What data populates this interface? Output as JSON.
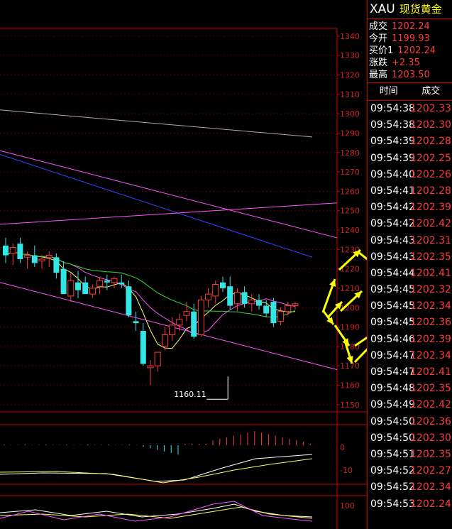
{
  "instrument": {
    "code": "XAU",
    "name": "现货黄金"
  },
  "quote": [
    {
      "label": "成交",
      "value": "1202.24"
    },
    {
      "label": "今开",
      "value": "1199.93"
    },
    {
      "label": "买价1",
      "value": "1202.24"
    },
    {
      "label": "涨跌",
      "value": "+2.35"
    },
    {
      "label": "最高",
      "value": "1203.50"
    }
  ],
  "ticks_header": {
    "time": "时间",
    "price": "成交"
  },
  "ticks": [
    {
      "time": "09:54:38",
      "price": "1202.33"
    },
    {
      "time": "09:54:38",
      "price": "1202.30"
    },
    {
      "time": "09:54:39",
      "price": "1202.28"
    },
    {
      "time": "09:54:39",
      "price": "1202.25"
    },
    {
      "time": "09:54:40",
      "price": "1202.26"
    },
    {
      "time": "09:54:41",
      "price": "1202.28"
    },
    {
      "time": "09:54:42",
      "price": "1202.39"
    },
    {
      "time": "09:54:42",
      "price": "1202.42"
    },
    {
      "time": "09:54:43",
      "price": "1202.31"
    },
    {
      "time": "09:54:43",
      "price": "1202.35"
    },
    {
      "time": "09:54:44",
      "price": "1202.41"
    },
    {
      "time": "09:54:45",
      "price": "1202.32"
    },
    {
      "time": "09:54:45",
      "price": "1202.34"
    },
    {
      "time": "09:54:45",
      "price": "1202.36"
    },
    {
      "time": "09:54:46",
      "price": "1202.39"
    },
    {
      "time": "09:54:47",
      "price": "1202.34"
    },
    {
      "time": "09:54:47",
      "price": "1202.41"
    },
    {
      "time": "09:54:48",
      "price": "1202.35"
    },
    {
      "time": "09:54:49",
      "price": "1202.42"
    },
    {
      "time": "09:54:50",
      "price": "1202.36"
    },
    {
      "time": "09:54:50",
      "price": "1202.30"
    },
    {
      "time": "09:54:51",
      "price": "1202.35"
    },
    {
      "time": "09:54:52",
      "price": "1202.27"
    },
    {
      "time": "09:54:52",
      "price": "1202.34"
    },
    {
      "time": "09:54:53",
      "price": "1202.24"
    }
  ],
  "colors": {
    "up": "#ff3b3b",
    "down": "#33e5e5",
    "axis": "#cc0000",
    "ma5": "#ffff66",
    "ma10": "#ff55ff",
    "ma20": "#33dd33",
    "ma60": "#3344ff",
    "ma120": "#aaaaaa",
    "channel": "#ff55ff",
    "arrow": "#ffff00"
  },
  "chart_data": {
    "type": "candlestick",
    "ylim": [
      1147,
      1344
    ],
    "yticks": [
      1150,
      1160,
      1170,
      1180,
      1190,
      1200,
      1210,
      1220,
      1230,
      1240,
      1250,
      1260,
      1270,
      1280,
      1290,
      1300,
      1310,
      1320,
      1330,
      1340
    ],
    "annotations": [
      {
        "text": "1160.11",
        "value": 1160.11,
        "index": 31
      }
    ],
    "candles": [
      {
        "o": 1232,
        "h": 1236,
        "l": 1223,
        "c": 1227
      },
      {
        "o": 1228,
        "h": 1233,
        "l": 1222,
        "c": 1231
      },
      {
        "o": 1233,
        "h": 1236,
        "l": 1223,
        "c": 1225
      },
      {
        "o": 1226,
        "h": 1229,
        "l": 1220,
        "c": 1227
      },
      {
        "o": 1227,
        "h": 1232,
        "l": 1221,
        "c": 1223
      },
      {
        "o": 1224,
        "h": 1227,
        "l": 1220,
        "c": 1225
      },
      {
        "o": 1226,
        "h": 1229,
        "l": 1221,
        "c": 1227
      },
      {
        "o": 1226,
        "h": 1228,
        "l": 1215,
        "c": 1218
      },
      {
        "o": 1220,
        "h": 1224,
        "l": 1212,
        "c": 1207
      },
      {
        "o": 1206,
        "h": 1218,
        "l": 1203,
        "c": 1214
      },
      {
        "o": 1213,
        "h": 1219,
        "l": 1205,
        "c": 1209
      },
      {
        "o": 1213,
        "h": 1216,
        "l": 1208,
        "c": 1207
      },
      {
        "o": 1207,
        "h": 1212,
        "l": 1205,
        "c": 1210
      },
      {
        "o": 1211,
        "h": 1216,
        "l": 1207,
        "c": 1214
      },
      {
        "o": 1214,
        "h": 1217,
        "l": 1209,
        "c": 1213
      },
      {
        "o": 1213,
        "h": 1216,
        "l": 1210,
        "c": 1215
      },
      {
        "o": 1213,
        "h": 1217,
        "l": 1210,
        "c": 1212
      },
      {
        "o": 1211,
        "h": 1214,
        "l": 1195,
        "c": 1196
      },
      {
        "o": 1193,
        "h": 1198,
        "l": 1188,
        "c": 1192
      },
      {
        "o": 1188,
        "h": 1192,
        "l": 1170,
        "c": 1171
      },
      {
        "o": 1169,
        "h": 1173,
        "l": 1160,
        "c": 1170
      },
      {
        "o": 1170,
        "h": 1176,
        "l": 1167,
        "c": 1177
      },
      {
        "o": 1180,
        "h": 1190,
        "l": 1178,
        "c": 1186
      },
      {
        "o": 1186,
        "h": 1195,
        "l": 1183,
        "c": 1191
      },
      {
        "o": 1191,
        "h": 1197,
        "l": 1188,
        "c": 1194
      },
      {
        "o": 1196,
        "h": 1203,
        "l": 1193,
        "c": 1198
      },
      {
        "o": 1198,
        "h": 1202,
        "l": 1184,
        "c": 1185
      },
      {
        "o": 1186,
        "h": 1206,
        "l": 1185,
        "c": 1204
      },
      {
        "o": 1204,
        "h": 1210,
        "l": 1200,
        "c": 1207
      },
      {
        "o": 1206,
        "h": 1214,
        "l": 1202,
        "c": 1212
      },
      {
        "o": 1213,
        "h": 1216,
        "l": 1208,
        "c": 1210
      },
      {
        "o": 1211,
        "h": 1216,
        "l": 1199,
        "c": 1201
      },
      {
        "o": 1202,
        "h": 1210,
        "l": 1198,
        "c": 1208
      },
      {
        "o": 1208,
        "h": 1211,
        "l": 1200,
        "c": 1202
      },
      {
        "o": 1202,
        "h": 1207,
        "l": 1198,
        "c": 1204
      },
      {
        "o": 1204,
        "h": 1207,
        "l": 1199,
        "c": 1201
      },
      {
        "o": 1201,
        "h": 1204,
        "l": 1195,
        "c": 1197
      },
      {
        "o": 1203,
        "h": 1205,
        "l": 1190,
        "c": 1192
      },
      {
        "o": 1193,
        "h": 1200,
        "l": 1191,
        "c": 1198
      },
      {
        "o": 1198,
        "h": 1203,
        "l": 1196,
        "c": 1201
      },
      {
        "o": 1201,
        "h": 1203,
        "l": 1199,
        "c": 1202
      }
    ]
  }
}
